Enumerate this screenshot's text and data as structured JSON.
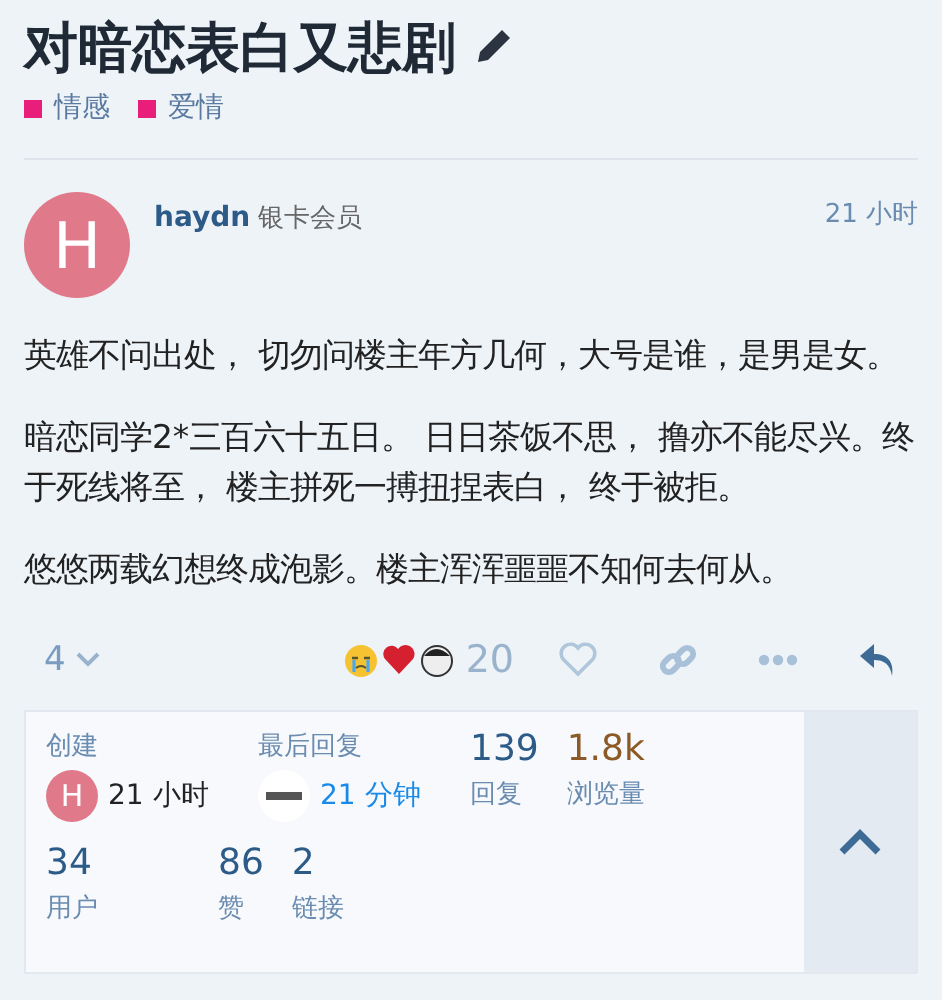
{
  "topic": {
    "title": "对暗恋表白又悲剧",
    "tags": [
      {
        "label": "情感",
        "color": "#e91e7a"
      },
      {
        "label": "爱情",
        "color": "#e91e7a"
      }
    ]
  },
  "post": {
    "avatar_letter": "H",
    "username": "haydn",
    "user_title": "银卡会员",
    "time": "21 小时",
    "paragraphs": [
      "英雄不问出处， 切勿问楼主年方几何，大号是谁，是男是女。",
      "暗恋同学2*三百六十五日。 日日茶饭不思， 撸亦不能尽兴。终于死线将至， 楼主拼死一搏扭捏表白， 终于被拒。",
      "悠悠两载幻想终成泡影。楼主浑浑噩噩不知何去何从。"
    ],
    "replies_count": "4",
    "reaction_count": "20"
  },
  "summary": {
    "items": [
      {
        "kind": "user",
        "label": "创建",
        "logo_avatar": false,
        "avatar_letter": "H",
        "time": "21 小时",
        "linked": false
      },
      {
        "kind": "user",
        "label": "最后回复",
        "logo_avatar": true,
        "time": "21 分钟",
        "linked": true
      },
      {
        "kind": "count",
        "value": "139",
        "label": "回复",
        "color": "#2d5b88"
      },
      {
        "kind": "count",
        "value": "1.8k",
        "label": "浏览量",
        "color": "#8c5a26"
      },
      {
        "kind": "count",
        "value": "34",
        "label": "用户",
        "color": "#2d5b88"
      },
      {
        "kind": "count",
        "value": "86",
        "label": "赞",
        "color": "#2d5b88"
      },
      {
        "kind": "count",
        "value": "2",
        "label": "链接",
        "color": "#2d5b88"
      }
    ]
  }
}
